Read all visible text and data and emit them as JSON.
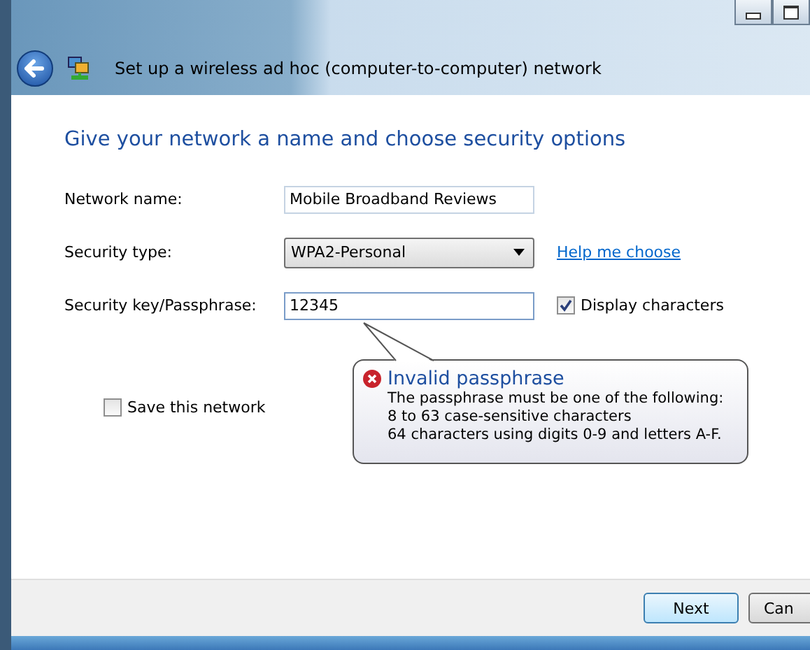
{
  "window": {
    "title": "Set up a wireless ad hoc (computer-to-computer) network"
  },
  "heading": "Give your network a name and choose security options",
  "fields": [
    {
      "kind": "text",
      "label": "Network name:",
      "value": "Mobile Broadband Reviews"
    },
    {
      "kind": "dropdown",
      "label": "Security type:",
      "value": "WPA2-Personal",
      "link": "Help me choose"
    },
    {
      "kind": "text",
      "label": "Security key/Passphrase:",
      "value": "12345",
      "checkbox": {
        "label": "Display characters",
        "checked": true
      }
    }
  ],
  "save_checkbox": {
    "label": "Save this network",
    "checked": false
  },
  "balloon": {
    "title": "Invalid passphrase",
    "lines": [
      "The passphrase must be one of the following:",
      "8 to 63 case-sensitive characters",
      "64 characters using digits 0-9 and letters A-F."
    ]
  },
  "buttons": [
    {
      "label": "Next"
    },
    {
      "label": "Can"
    }
  ]
}
